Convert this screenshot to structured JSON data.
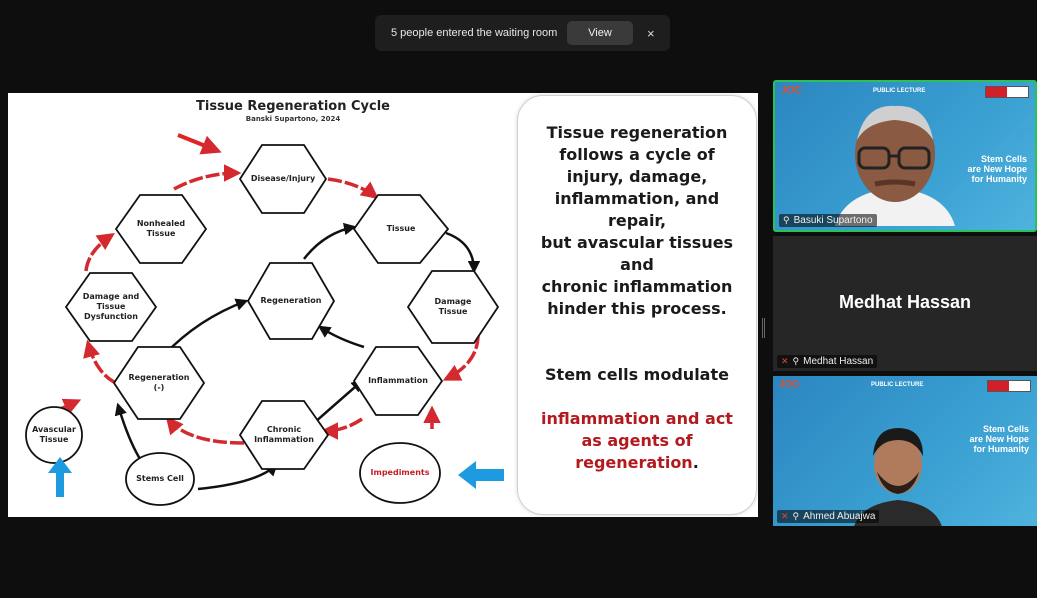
{
  "notification": {
    "message": "5 people entered the waiting room",
    "view_label": "View",
    "close_icon": "×"
  },
  "diagram": {
    "title": "Tissue Regeneration Cycle",
    "subtitle": "Banski Supartono, 2024",
    "nodes": {
      "disease": "Disease/Injury",
      "tissue": "Tissue",
      "damage": "Damage\nTissue",
      "inflammation": "Inflammation",
      "chronic": "Chronic\nInflammation",
      "regen_minus": "Regeneration\n(-)",
      "regeneration": "Regeneration",
      "nonhealed": "Nonhealed\nTissue",
      "dysfunction": "Damage and\nTissue\nDysfunction",
      "avascular": "Avascular\nTissue",
      "stem": "Stems Cell",
      "impediments": "Impediments"
    },
    "colors": {
      "cycle": "#d42a2f",
      "flow": "#111111",
      "pointer_red": "#e02424",
      "pointer_blue": "#1e9be0"
    }
  },
  "slide_text": {
    "para1": "Tissue regeneration\nfollows a cycle of\ninjury, damage,\ninflammation, and\nrepair,\nbut avascular tissues\nand\nchronic inflammation\nhinder this process.",
    "para2_black": "Stem cells modulate",
    "para2_red": "inflammation and act\nas agents of\nregeneration",
    "para2_end": "."
  },
  "participants": [
    {
      "name": "Basuki Supartono",
      "banner": "Stem Cells\nare New Hope\nfor Humanity",
      "lecture": "PUBLIC LECTURE"
    },
    {
      "name": "Medhat Hassan",
      "big_name": "Medhat Hassan"
    },
    {
      "name": "Ahmed Abuajwa",
      "banner": "Stem Cells\nare New Hope\nfor Humanity",
      "lecture": "PUBLIC LECTURE"
    }
  ],
  "logo_text": "JOC"
}
